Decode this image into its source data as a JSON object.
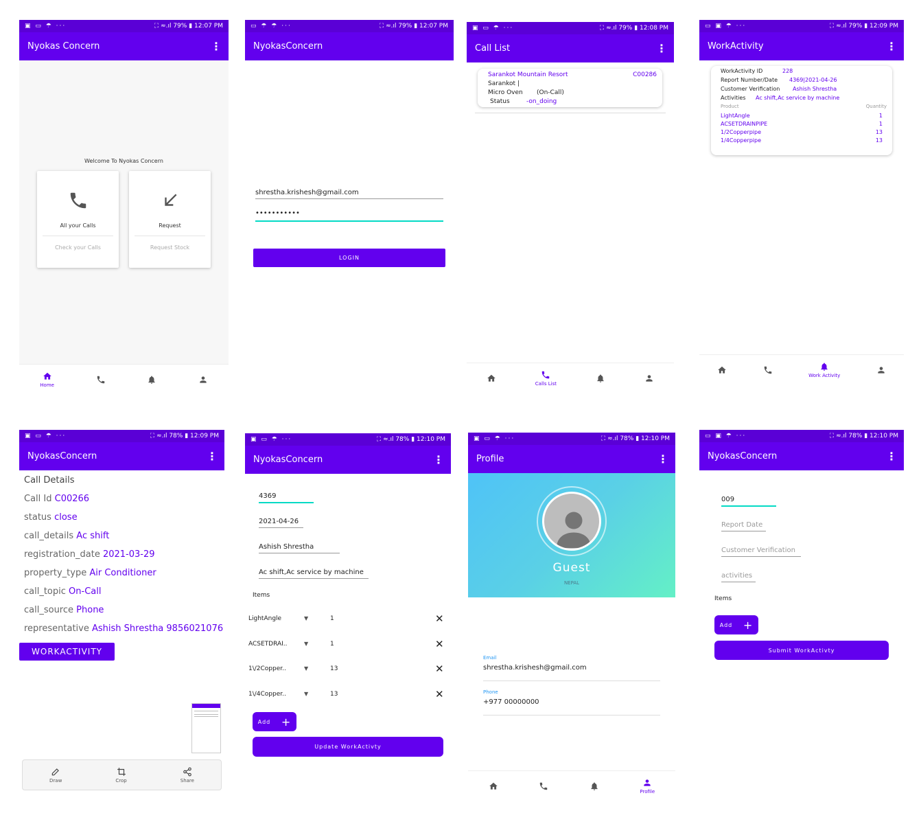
{
  "status": {
    "s1": {
      "left": "▣ ▭ ☂ ···",
      "right": "⛶ ≈.ıl 79% ▮ 12:07 PM"
    },
    "s2": {
      "left": "▭ ☂ ☂ ···",
      "right": "⛶ ≈.ıl 79% ▮ 12:07 PM"
    },
    "s3": {
      "left": "▣ ▭ ☂ ···",
      "right": "⛶ ≈.ıl 79% ▮ 12:08 PM"
    },
    "s4": {
      "left": "▭ ▣ ☂ ···",
      "right": "⛶ ≈.ıl 79% ▮ 12:09 PM"
    },
    "s5": {
      "left": "▣ ▭ ☂ ···",
      "right": "⛶ ≈.ıl 78% ▮ 12:09 PM"
    },
    "s6": {
      "left": "▣ ▭ ☂ ···",
      "right": "⛶ ≈.ıl 78% ▮ 12:10 PM"
    },
    "s7": {
      "left": "▣ ▭ ☂ ···",
      "right": "⛶ ≈.ıl 78% ▮ 12:10 PM"
    },
    "s8": {
      "left": "▭ ▣ ☂ ···",
      "right": "⛶ ≈.ıl 78% ▮ 12:10 PM"
    }
  },
  "screen1": {
    "title": "Nyokas Concern",
    "welcome": "Welcome To Nyokas Concern",
    "card1": {
      "title": "All your Calls",
      "sub": "Check your Calls"
    },
    "card2": {
      "title": "Request",
      "sub": "Request Stock"
    },
    "nav_home": "Home"
  },
  "screen2": {
    "title": "NyokasConcern",
    "email": "shrestha.krishesh@gmail.com",
    "password": "•••••••••••",
    "login": "LOGIN"
  },
  "screen3": {
    "title": "Call List",
    "item": {
      "name": "Sarankot Mountain Resort",
      "code": "C00286",
      "place": "Sarankot |",
      "product": "Micro Oven",
      "type": "(On-Call)",
      "status_label": "Status",
      "status_value": "-on_doing"
    },
    "nav_calls": "Calls List"
  },
  "screen4": {
    "title": "WorkActivity",
    "id_label": "WorkActivity ID",
    "id_value": "228",
    "report_label": "Report Number/Date",
    "report_value": "4369|2021-04-26",
    "cust_label": "Customer Verification",
    "cust_value": "Ashish Shrestha",
    "act_label": "Activities",
    "act_value": "Ac shift,Ac service by machine",
    "product_hdr": "Product",
    "qty_hdr": "Quantity",
    "rows": [
      {
        "name": "LightAngle",
        "qty": "1"
      },
      {
        "name": "ACSETDRAINPIPE",
        "qty": "1"
      },
      {
        "name": "1/2Copperpipe",
        "qty": "13"
      },
      {
        "name": "1/4Copperpipe",
        "qty": "13"
      }
    ],
    "nav_work": "Work Activity"
  },
  "screen5": {
    "title": "NyokasConcern",
    "heading": "Call Details",
    "fields": [
      {
        "label": "Call Id",
        "value": "C00266"
      },
      {
        "label": "status",
        "value": "close"
      },
      {
        "label": "call_details",
        "value": "Ac shift"
      },
      {
        "label": "registration_date",
        "value": "2021-03-29"
      },
      {
        "label": "property_type",
        "value": "Air Conditioner"
      },
      {
        "label": "call_topic",
        "value": "On-Call"
      },
      {
        "label": "call_source",
        "value": "Phone"
      },
      {
        "label": "representative",
        "value": "Ashish Shrestha 9856021076"
      }
    ],
    "button": "WORKACTIVITY",
    "tools": {
      "draw": "Draw",
      "crop": "Crop",
      "share": "Share"
    }
  },
  "screen6": {
    "title": "NyokasConcern",
    "report": "4369",
    "date": "2021-04-26",
    "customer": "Ashish Shrestha",
    "activities": "Ac shift,Ac service by machine",
    "items_label": "Items",
    "items": [
      {
        "name": "LightAngle",
        "qty": "1"
      },
      {
        "name": "ACSETDRAI..",
        "qty": "1"
      },
      {
        "name": "1\\/2Copper..",
        "qty": "13"
      },
      {
        "name": "1\\/4Copper..",
        "qty": "13"
      }
    ],
    "add": "Add",
    "update": "Update WorkActivty"
  },
  "screen7": {
    "title": "Profile",
    "name": "Guest",
    "country": "NEPAL",
    "email_label": "Email",
    "email": "shrestha.krishesh@gmail.com",
    "phone_label": "Phone",
    "phone": "+977 00000000",
    "nav_profile": "Profile"
  },
  "screen8": {
    "title": "NyokasConcern",
    "value": "009",
    "report_date": "Report Date",
    "customer": "Customer Verification",
    "activities": "activities",
    "items_label": "Items",
    "add": "Add",
    "submit": "Submit WorkActivty"
  },
  "colors": {
    "primary": "#6200ee",
    "status_bar": "#5a00d6",
    "accent": "#03dac5"
  }
}
